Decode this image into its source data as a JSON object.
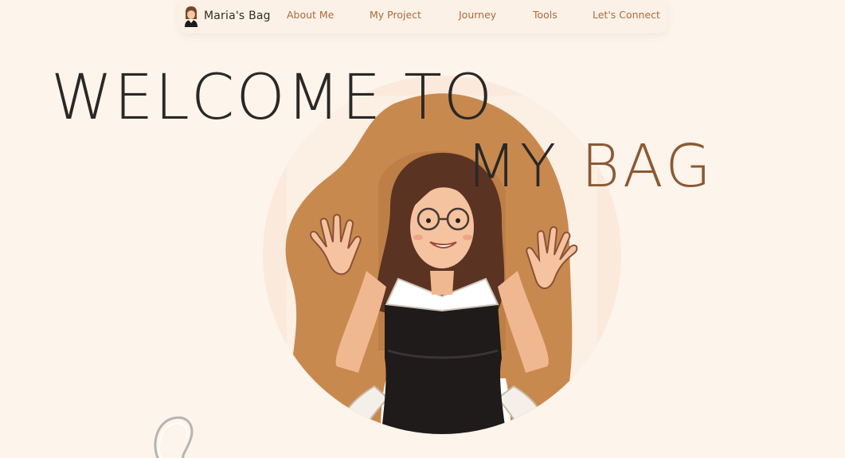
{
  "nav": {
    "brand": "Maria's Bag",
    "links": [
      "About Me",
      "My Project",
      "Journey",
      "Tools",
      "Let's Connect"
    ]
  },
  "hero": {
    "line1": "WELCOME TO",
    "line2_word1": "MY",
    "line2_word2": "BAG"
  },
  "colors": {
    "background": "#fdf4ec",
    "nav_link": "#a86b3c",
    "heading_dark": "#2a2826",
    "heading_accent": "#8a5a33",
    "blob": "#c8894f"
  },
  "icons": {
    "brand": "girl-avatar-icon",
    "decoration": "scribble-loop"
  }
}
